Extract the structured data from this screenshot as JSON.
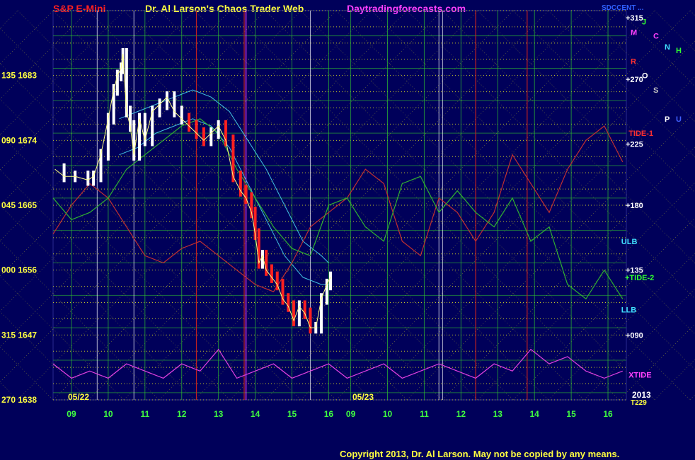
{
  "header": {
    "symbol": "S&P E-Mini",
    "title": "Dr. Al Larson's Chaos Trader Web",
    "site": "Daytradingforecasts.com",
    "corner": "SDCCENT ..."
  },
  "footer": {
    "copyright": "Copyright 2013, Dr. Al Larson. May not be copied by any means."
  },
  "colors": {
    "background": "#00005a",
    "grid_yellow": "#d8d820",
    "grid_green": "#30c030",
    "price_white": "#ffffff",
    "price_red": "#ff2020",
    "forecast_red": "#c03030",
    "forecast_green": "#30b030",
    "band_cyan": "#40c0e0",
    "xtide_magenta": "#e040e0"
  },
  "chart_data": {
    "type": "line",
    "title": "S&P E-Mini",
    "x_range": [
      8.5,
      16.1
    ],
    "y_range": [
      1638,
      1692
    ],
    "y_ticks": [
      {
        "angle": "270",
        "price": "1638",
        "value": 1638
      },
      {
        "angle": "315",
        "price": "1647",
        "value": 1647
      },
      {
        "angle": "000",
        "price": "1656",
        "value": 1656
      },
      {
        "angle": "045",
        "price": "1665",
        "value": 1665
      },
      {
        "angle": "090",
        "price": "1674",
        "value": 1674
      },
      {
        "angle": "135",
        "price": "1683",
        "value": 1683
      }
    ],
    "x_ticks_day1": [
      "09",
      "10",
      "11",
      "12",
      "13",
      "14",
      "15",
      "16"
    ],
    "x_ticks_day2": [
      "09",
      "10",
      "11",
      "12",
      "13",
      "14",
      "15",
      "16"
    ],
    "dates": [
      "05/22",
      "05/23"
    ],
    "year_label": "2013",
    "year_sub": "T229",
    "price_series": {
      "name": "ES price 05/22",
      "x": [
        8.55,
        8.8,
        9.1,
        9.45,
        9.6,
        9.8,
        10.0,
        10.15,
        10.25,
        10.35,
        10.4,
        10.5,
        10.6,
        10.7,
        10.85,
        11.0,
        11.2,
        11.4,
        11.6,
        11.8,
        12.0,
        12.2,
        12.4,
        12.6,
        12.8,
        13.0,
        13.2,
        13.4,
        13.6,
        13.75,
        13.9,
        14.0,
        14.1,
        14.2,
        14.3,
        14.45,
        14.6,
        14.75,
        14.9,
        15.05,
        15.2,
        15.35,
        15.5,
        15.65,
        15.8,
        15.95,
        16.05
      ],
      "y": [
        1670,
        1669,
        1669,
        1668.5,
        1669,
        1672,
        1677,
        1681,
        1683,
        1684,
        1686,
        1678,
        1676,
        1672,
        1677,
        1674,
        1678,
        1679,
        1680,
        1678,
        1677,
        1676,
        1675,
        1674,
        1675,
        1676,
        1674,
        1669,
        1667,
        1666,
        1664,
        1661,
        1657,
        1658,
        1656,
        1655,
        1654,
        1652,
        1651,
        1649,
        1651,
        1650,
        1648,
        1648,
        1652,
        1654,
        1655
      ]
    },
    "forecast_series": [
      {
        "name": "forecast-red",
        "x": [
          8.5,
          9.0,
          9.5,
          10.0,
          10.5,
          11.0,
          11.5,
          12.0,
          12.5,
          13.0,
          13.5,
          14.0,
          14.5,
          15.0,
          15.5,
          16.0,
          16.5,
          17.0,
          17.5,
          18.0,
          18.5,
          19.0,
          19.5,
          20.0,
          20.5,
          21.0,
          21.5,
          22.0,
          22.5,
          23.0,
          23.5,
          24.0
        ],
        "y": [
          1661,
          1665,
          1668,
          1666,
          1662,
          1658,
          1657,
          1659,
          1660,
          1658,
          1656,
          1654,
          1653,
          1657,
          1662,
          1664,
          1666,
          1670,
          1668,
          1660,
          1658,
          1666,
          1664,
          1660,
          1664,
          1672,
          1668,
          1664,
          1670,
          1674,
          1676,
          1671
        ]
      },
      {
        "name": "forecast-green",
        "x": [
          8.5,
          9.0,
          9.5,
          10.0,
          10.5,
          11.0,
          11.5,
          12.0,
          12.5,
          13.0,
          13.5,
          14.0,
          14.5,
          15.0,
          15.5,
          16.0,
          16.5,
          17.0,
          17.5,
          18.0,
          18.5,
          19.0,
          19.5,
          20.0,
          20.5,
          21.0,
          21.5,
          22.0,
          22.5,
          23.0,
          23.5,
          24.0
        ],
        "y": [
          1666,
          1663,
          1664,
          1666,
          1670,
          1672,
          1674,
          1676,
          1677,
          1675,
          1670,
          1666,
          1662,
          1659,
          1658,
          1665,
          1666,
          1662,
          1660,
          1668,
          1669,
          1664,
          1667,
          1664,
          1662,
          1666,
          1660,
          1662,
          1654,
          1652,
          1656,
          1652
        ]
      }
    ],
    "band_series": [
      {
        "name": "band-upper",
        "x": [
          10.3,
          10.8,
          11.3,
          11.8,
          12.3,
          12.8,
          13.3,
          13.8,
          14.3,
          14.8,
          15.3,
          15.8,
          16.0
        ],
        "y": [
          1677,
          1678,
          1679,
          1680,
          1681,
          1680,
          1678,
          1674,
          1670,
          1665,
          1660,
          1658,
          1657
        ]
      },
      {
        "name": "band-lower",
        "x": [
          10.3,
          10.8,
          11.3,
          11.8,
          12.3,
          12.8,
          13.3,
          13.8,
          14.3,
          14.8,
          15.3,
          15.8,
          16.0
        ],
        "y": [
          1672,
          1673,
          1675,
          1676,
          1677,
          1676,
          1673,
          1668,
          1663,
          1658,
          1655,
          1654,
          1654
        ]
      }
    ],
    "xtide": {
      "name": "XTIDE",
      "x": [
        8.5,
        9.0,
        9.5,
        10.0,
        10.5,
        11.0,
        11.5,
        12.0,
        12.5,
        13.0,
        13.5,
        14.0,
        14.5,
        15.0,
        15.5,
        16.0,
        16.5,
        17.0,
        17.5,
        18.0,
        18.5,
        19.0,
        19.5,
        20.0,
        20.5,
        21.0,
        21.5,
        22.0,
        22.5,
        23.0,
        23.5,
        24.0
      ],
      "y": [
        1643,
        1641,
        1642,
        1641,
        1643,
        1642,
        1641,
        1643,
        1642,
        1645,
        1641,
        1642,
        1643,
        1641,
        1642,
        1643,
        1641,
        1642,
        1643,
        1641,
        1642,
        1643,
        1642,
        1641,
        1643,
        1642,
        1645,
        1643,
        1644,
        1642,
        1641,
        1642
      ]
    },
    "series_labels": [
      {
        "text": "TIDE-1",
        "x": 24.2,
        "y": 1675,
        "color": "#ff3030"
      },
      {
        "text": "+TIDE-2",
        "x": 24.1,
        "y": 1655,
        "color": "#30ff30"
      },
      {
        "text": "XTIDE",
        "x": 24.2,
        "y": 1641.5,
        "color": "#ff40ff"
      },
      {
        "text": "ULB",
        "x": 24.0,
        "y": 1660,
        "color": "#40e0ff"
      },
      {
        "text": "LLB",
        "x": 24.0,
        "y": 1650.5,
        "color": "#40e0ff"
      }
    ],
    "right_level_labels": [
      {
        "text": "+315",
        "y": 1691
      },
      {
        "text": "+270",
        "y": 1682.5
      },
      {
        "text": "+225",
        "y": 1673.5
      },
      {
        "text": "+180",
        "y": 1665
      },
      {
        "text": "+135",
        "y": 1656
      },
      {
        "text": "+090",
        "y": 1647
      }
    ],
    "planet_glyphs": [
      {
        "text": "M",
        "color": "#ff40ff",
        "y": 1689
      },
      {
        "text": "J",
        "color": "#30ff30",
        "y": 1690.5
      },
      {
        "text": "C",
        "color": "#ff40ff",
        "y": 1688.5
      },
      {
        "text": "N",
        "color": "#40e0ff",
        "y": 1687
      },
      {
        "text": "H",
        "color": "#30ff30",
        "y": 1686.5
      },
      {
        "text": "R",
        "color": "#ff3030",
        "y": 1685
      },
      {
        "text": "O",
        "color": "#ffffff",
        "y": 1683
      },
      {
        "text": "S",
        "color": "#c0c0c0",
        "y": 1681
      },
      {
        "text": "P",
        "color": "#ffffff",
        "y": 1677
      },
      {
        "text": "U",
        "color": "#4060ff",
        "y": 1677
      }
    ],
    "grid_on": true
  }
}
